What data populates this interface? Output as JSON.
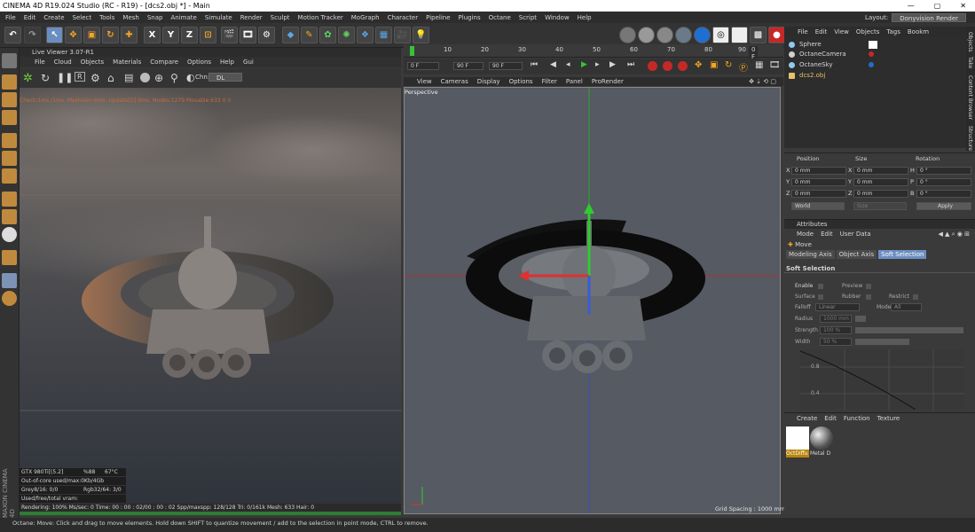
{
  "window": {
    "title": "CINEMA 4D R19.024 Studio (RC - R19) - [dcs2.obj *] - Main",
    "minimize": "—",
    "maximize": "▢",
    "close": "✕"
  },
  "menubar": {
    "items": [
      "File",
      "Edit",
      "Create",
      "Select",
      "Tools",
      "Mesh",
      "Snap",
      "Animate",
      "Simulate",
      "Render",
      "Sculpt",
      "Motion Tracker",
      "MoGraph",
      "Character",
      "Pipeline",
      "Plugins",
      "Octane",
      "Script",
      "Window",
      "Help"
    ],
    "layout_label": "Layout:",
    "layout_value": "Donyvision Render"
  },
  "toolbar": {
    "axis": [
      "X",
      "Y",
      "Z"
    ]
  },
  "live_viewer": {
    "title": "Live Viewer 3.07-R1",
    "menu": [
      "File",
      "Cloud",
      "Objects",
      "Materials",
      "Compare",
      "Options",
      "Help",
      "Gui"
    ],
    "channel_label": "Chn:",
    "channel_value": "DL",
    "status_line": "Check:1ms./1ms. MeshGen:6ms. Update[G]:0ms. Nodes:1279 Movable:633  0 0",
    "stats": [
      [
        "GTX 980Ti[(5.2]",
        "%88",
        "67°C"
      ],
      [
        "Out-of-core used/max:0Kb/4Gb",
        "",
        ""
      ],
      [
        "Grey8/16: 0/0",
        "Rgb32/64: 3/0",
        ""
      ],
      [
        "Used/free/total vram: 320Mb/2.821Gb/4Gb",
        "",
        ""
      ]
    ],
    "render_status": "Rendering: 100%   Ms/sec: 0   Time: 00 : 00 : 02/00 : 00 : 02   Spp/maxspp: 128/128   Tri: 0/161k   Mesh: 633  Hair: 0",
    "progress": 1.0
  },
  "timeline": {
    "ticks": [
      "0",
      "10",
      "20",
      "30",
      "40",
      "50",
      "60",
      "70",
      "80",
      "90"
    ],
    "end_frame": "0 F",
    "field_start": "0 F",
    "field_mid": "90 F",
    "field_end": "90 F"
  },
  "viewport": {
    "menu": [
      "View",
      "Cameras",
      "Display",
      "Options",
      "Filter",
      "Panel",
      "ProRender"
    ],
    "label": "Perspective",
    "grid_spacing": "Grid Spacing : 1000 mm"
  },
  "object_manager": {
    "menu": [
      "File",
      "Edit",
      "View",
      "Objects",
      "Tags",
      "Bookm"
    ],
    "objects": [
      {
        "name": "Sphere",
        "color": "#8ecbf2"
      },
      {
        "name": "OctaneCamera",
        "color": "#d0d0d0"
      },
      {
        "name": "OctaneSky",
        "color": "#8ecbf2"
      },
      {
        "name": "dcs2.obj",
        "color": "#e8c06a"
      }
    ],
    "side_tabs": [
      "Objects",
      "Take",
      "Content Browser",
      "Structure"
    ]
  },
  "coordinates": {
    "headers": [
      "Position",
      "Size",
      "Rotation"
    ],
    "rows": [
      [
        "X",
        "0 mm",
        "X",
        "0 mm",
        "H",
        "0 °"
      ],
      [
        "Y",
        "0 mm",
        "Y",
        "0 mm",
        "P",
        "0 °"
      ],
      [
        "Z",
        "0 mm",
        "Z",
        "0 mm",
        "B",
        "0 °"
      ]
    ],
    "space": "World",
    "size_mode": "Size",
    "apply": "Apply"
  },
  "attributes": {
    "title": "Attributes",
    "menu": [
      "Mode",
      "Edit",
      "User Data"
    ],
    "tool": "Move",
    "tabs": [
      "Modeling Axis",
      "Object Axis",
      "Soft Selection"
    ],
    "section": "Soft Selection",
    "fields": {
      "enable": "Enable",
      "preview": "Preview",
      "surface": "Surface",
      "rubber": "Rubber",
      "restrict": "Restrict",
      "falloff": "Falloff",
      "falloff_value": "Linear",
      "mode": "Mode",
      "mode_value": "All",
      "radius": "Radius",
      "radius_value": "1000 mm",
      "strength": "Strength",
      "strength_value": "100 %",
      "width": "Width",
      "width_value": "50 %"
    },
    "graph_labels": [
      "0.8",
      "0.4"
    ]
  },
  "material_manager": {
    "menu": [
      "Create",
      "Edit",
      "Function",
      "Texture"
    ],
    "materials": [
      "OctDiffu",
      "Metal D"
    ]
  },
  "statusbar": {
    "text": "Octane:   Move: Click and drag to move elements. Hold down SHIFT to quantize movement / add to the selection in point mode, CTRL to remove."
  },
  "colors": {
    "accent": "#6b8ec1",
    "brand_text": "#ffffff"
  }
}
